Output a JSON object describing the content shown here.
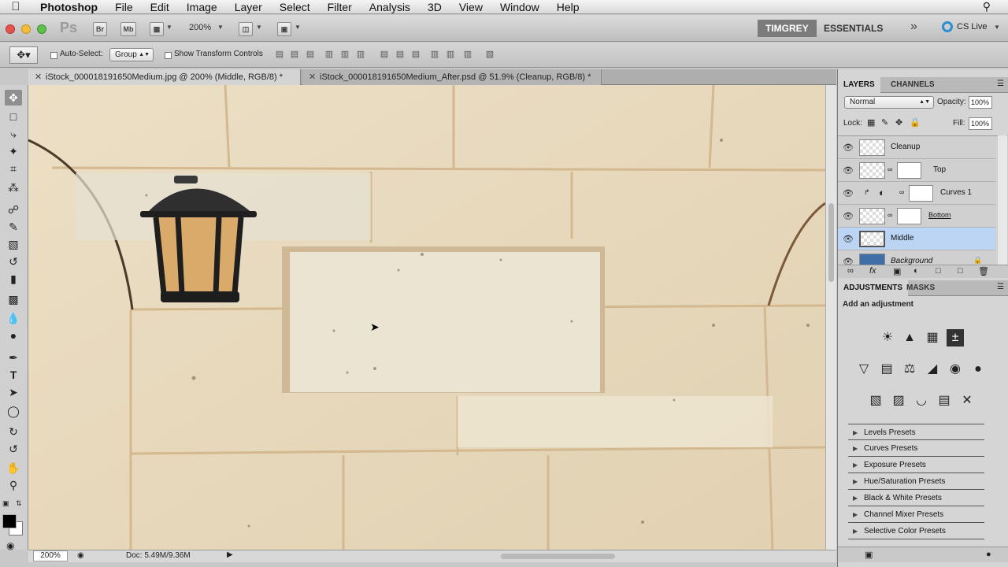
{
  "menubar": {
    "apple": "",
    "items": [
      "Photoshop",
      "File",
      "Edit",
      "Image",
      "Layer",
      "Select",
      "Filter",
      "Analysis",
      "3D",
      "View",
      "Window",
      "Help"
    ]
  },
  "appbar": {
    "ps_logo": "Ps",
    "br": "Br",
    "mb": "Mb",
    "zoom": "200%",
    "workspace_user": "TIMGREY",
    "workspace_essentials": "ESSENTIALS",
    "more": "»",
    "cs_live": "CS Live"
  },
  "options": {
    "auto_select_label": "Auto-Select:",
    "auto_select_value": "Group",
    "show_transform_label": "Show Transform Controls"
  },
  "tabs": [
    {
      "label": "iStock_000018191650Medium.jpg @ 200% (Middle, RGB/8) *",
      "active": true
    },
    {
      "label": "iStock_000018191650Medium_After.psd @ 51.9% (Cleanup, RGB/8) *",
      "active": false
    }
  ],
  "status": {
    "zoom": "200%",
    "doc": "Doc: 5.49M/9.36M"
  },
  "layers_panel": {
    "tab_layers": "LAYERS",
    "tab_channels": "CHANNELS",
    "blend_mode": "Normal",
    "opacity_label": "Opacity:",
    "opacity_value": "100%",
    "lock_label": "Lock:",
    "fill_label": "Fill:",
    "fill_value": "100%",
    "layers": [
      {
        "name": "Cleanup",
        "mask": false,
        "selected": false
      },
      {
        "name": "Top",
        "mask": true,
        "selected": false
      },
      {
        "name": "Curves 1",
        "mask": true,
        "selected": false
      },
      {
        "name": "Bottom",
        "mask": true,
        "selected": false
      },
      {
        "name": "Middle",
        "mask": false,
        "selected": true
      },
      {
        "name": "Background",
        "mask": false,
        "selected": false
      }
    ]
  },
  "adjustments_panel": {
    "tab_adjustments": "ADJUSTMENTS",
    "tab_masks": "MASKS",
    "heading": "Add an adjustment",
    "presets": [
      "Levels Presets",
      "Curves Presets",
      "Exposure Presets",
      "Hue/Saturation Presets",
      "Black & White Presets",
      "Channel Mixer Presets",
      "Selective Color Presets"
    ]
  },
  "colors": {
    "selected_layer": "#bcd5f5",
    "panel_bg": "#d5d5d5",
    "stone": "#e9dcc2"
  }
}
